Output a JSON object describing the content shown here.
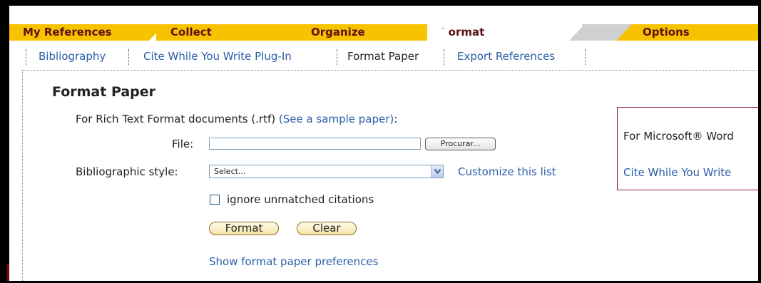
{
  "tabs": [
    {
      "label": "My References"
    },
    {
      "label": "Collect"
    },
    {
      "label": "Organize"
    },
    {
      "label": "Format"
    },
    {
      "label": "Options"
    }
  ],
  "subnav": [
    {
      "label": "Bibliography"
    },
    {
      "label": "Cite While You Write Plug-In"
    },
    {
      "label": "Format Paper"
    },
    {
      "label": "Export References"
    }
  ],
  "page": {
    "title": "Format Paper",
    "rtf_intro": "For Rich Text Format documents (.rtf)",
    "rtf_sample_link": "(See a sample paper)",
    "rtf_colon": ":",
    "file_label": "File:",
    "file_value": "",
    "browse_label": "Procurar...",
    "style_label": "Bibliographic style:",
    "style_selected": "Select...",
    "customize_link": "Customize this list",
    "ignore_label": "ignore unmatched citations",
    "ignore_checked": false,
    "format_button": "Format",
    "clear_button": "Clear",
    "preferences_link": "Show format paper preferences"
  },
  "word_box": {
    "text": "For Microsoft® Word",
    "link": "Cite While You Write"
  },
  "colors": {
    "tab_yellow": "#f7c200",
    "tab_text": "#5c1111",
    "link_blue": "#2a5ea8",
    "box_border": "#8a1a3a"
  }
}
